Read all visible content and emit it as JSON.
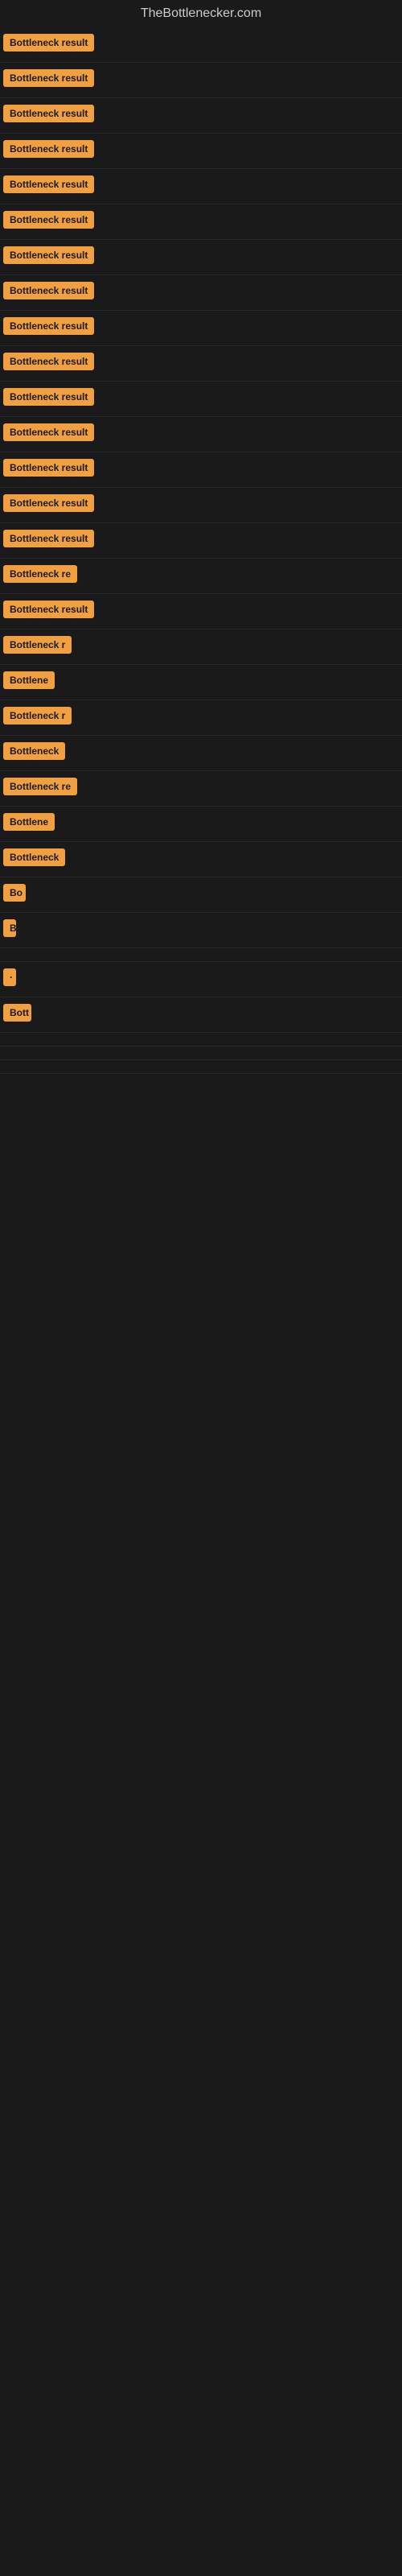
{
  "site": {
    "title": "TheBottlenecker.com"
  },
  "results": [
    {
      "id": 1,
      "label": "Bottleneck result",
      "width": 140
    },
    {
      "id": 2,
      "label": "Bottleneck result",
      "width": 140
    },
    {
      "id": 3,
      "label": "Bottleneck result",
      "width": 140
    },
    {
      "id": 4,
      "label": "Bottleneck result",
      "width": 140
    },
    {
      "id": 5,
      "label": "Bottleneck result",
      "width": 140
    },
    {
      "id": 6,
      "label": "Bottleneck result",
      "width": 140
    },
    {
      "id": 7,
      "label": "Bottleneck result",
      "width": 140
    },
    {
      "id": 8,
      "label": "Bottleneck result",
      "width": 140
    },
    {
      "id": 9,
      "label": "Bottleneck result",
      "width": 140
    },
    {
      "id": 10,
      "label": "Bottleneck result",
      "width": 140
    },
    {
      "id": 11,
      "label": "Bottleneck result",
      "width": 140
    },
    {
      "id": 12,
      "label": "Bottleneck result",
      "width": 140
    },
    {
      "id": 13,
      "label": "Bottleneck result",
      "width": 140
    },
    {
      "id": 14,
      "label": "Bottleneck result",
      "width": 140
    },
    {
      "id": 15,
      "label": "Bottleneck result",
      "width": 140
    },
    {
      "id": 16,
      "label": "Bottleneck re",
      "width": 105
    },
    {
      "id": 17,
      "label": "Bottleneck result",
      "width": 120
    },
    {
      "id": 18,
      "label": "Bottleneck r",
      "width": 95
    },
    {
      "id": 19,
      "label": "Bottlene",
      "width": 75
    },
    {
      "id": 20,
      "label": "Bottleneck r",
      "width": 90
    },
    {
      "id": 21,
      "label": "Bottleneck",
      "width": 82
    },
    {
      "id": 22,
      "label": "Bottleneck re",
      "width": 100
    },
    {
      "id": 23,
      "label": "Bottlene",
      "width": 72
    },
    {
      "id": 24,
      "label": "Bottleneck",
      "width": 78
    },
    {
      "id": 25,
      "label": "Bo",
      "width": 28
    },
    {
      "id": 26,
      "label": "B",
      "width": 14
    },
    {
      "id": 27,
      "label": "",
      "width": 8
    },
    {
      "id": 28,
      "label": "·",
      "width": 6
    },
    {
      "id": 29,
      "label": "Bott",
      "width": 35
    },
    {
      "id": 30,
      "label": "",
      "width": 0
    },
    {
      "id": 31,
      "label": "",
      "width": 0
    },
    {
      "id": 32,
      "label": "",
      "width": 0
    }
  ]
}
